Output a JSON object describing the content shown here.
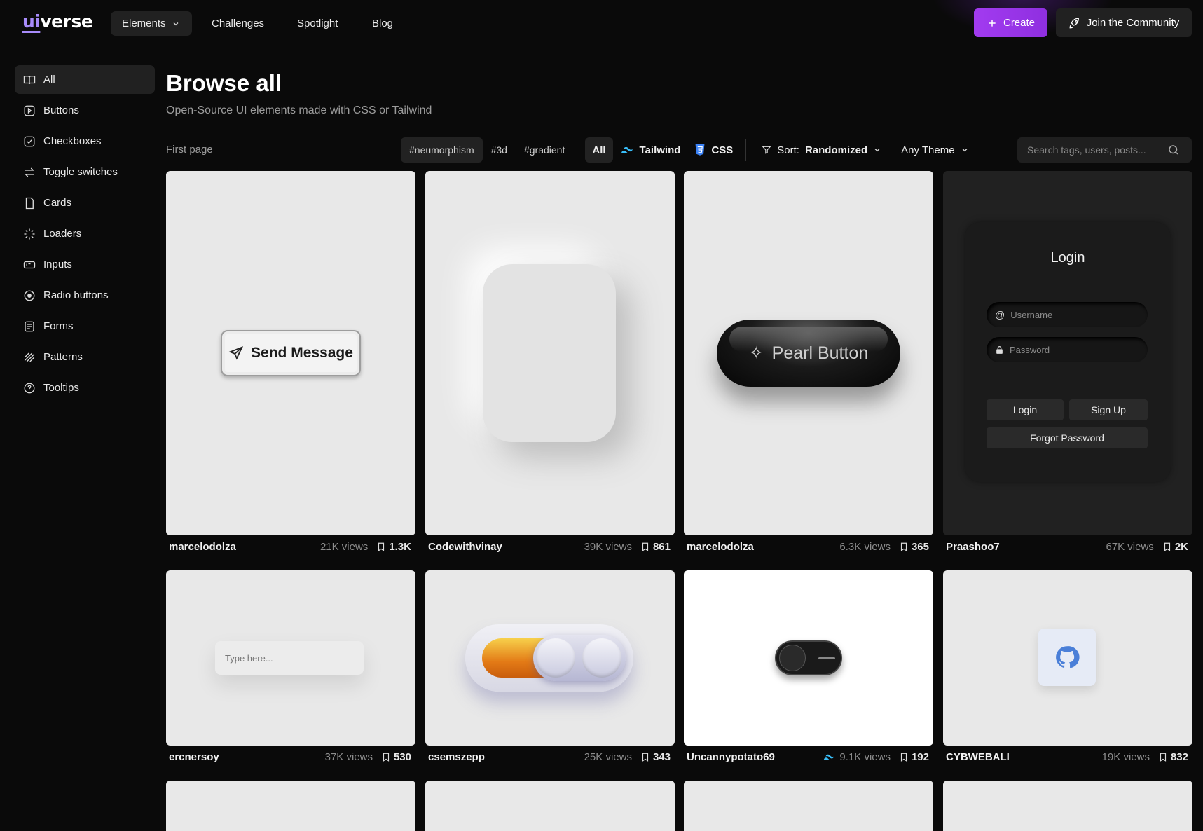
{
  "logo": {
    "ui": "ui",
    "rest": "verse"
  },
  "nav": {
    "elements": "Elements",
    "challenges": "Challenges",
    "spotlight": "Spotlight",
    "blog": "Blog"
  },
  "actions": {
    "create": "Create",
    "join": "Join the Community"
  },
  "sidebar": {
    "items": [
      {
        "label": "All",
        "icon": "book-open-icon"
      },
      {
        "label": "Buttons",
        "icon": "button-icon"
      },
      {
        "label": "Checkboxes",
        "icon": "checkbox-icon"
      },
      {
        "label": "Toggle switches",
        "icon": "arrows-swap-icon"
      },
      {
        "label": "Cards",
        "icon": "card-icon"
      },
      {
        "label": "Loaders",
        "icon": "loader-icon"
      },
      {
        "label": "Inputs",
        "icon": "input-icon"
      },
      {
        "label": "Radio buttons",
        "icon": "radio-icon"
      },
      {
        "label": "Forms",
        "icon": "form-icon"
      },
      {
        "label": "Patterns",
        "icon": "pattern-icon"
      },
      {
        "label": "Tooltips",
        "icon": "help-circle-icon"
      }
    ]
  },
  "header": {
    "title": "Browse all",
    "subtitle": "Open-Source UI elements made with CSS or Tailwind"
  },
  "filters": {
    "first_page": "First page",
    "tags": [
      "#neumorphism",
      "#3d",
      "#gradient"
    ],
    "frameworks": [
      "All",
      "Tailwind",
      "CSS"
    ],
    "sort_label": "Sort:",
    "sort_value": "Randomized",
    "theme": "Any Theme",
    "search_placeholder": "Search tags, users, posts..."
  },
  "cards": [
    {
      "author": "marcelodolza",
      "views": "21K views",
      "saves": "1.3K",
      "content": "Send Message"
    },
    {
      "author": "Codewithvinay",
      "views": "39K views",
      "saves": "861"
    },
    {
      "author": "marcelodolza",
      "views": "6.3K views",
      "saves": "365",
      "content": "Pearl Button"
    },
    {
      "author": "Praashoo7",
      "views": "67K views",
      "saves": "2K",
      "login": {
        "title": "Login",
        "username": "Username",
        "password": "Password",
        "login_btn": "Login",
        "signup_btn": "Sign Up",
        "forgot_btn": "Forgot Password"
      }
    },
    {
      "author": "ercnersoy",
      "views": "37K views",
      "saves": "530",
      "placeholder": "Type here..."
    },
    {
      "author": "csemszepp",
      "views": "25K views",
      "saves": "343"
    },
    {
      "author": "Uncannypotato69",
      "views": "9.1K views",
      "saves": "192"
    },
    {
      "author": "CYBWEBALI",
      "views": "19K views",
      "saves": "832"
    }
  ],
  "colors": {
    "accent": "#9f3cf0",
    "bg": "#0a0a0a",
    "card_bg": "#e8e8e8",
    "tailwind": "#38bdf8",
    "css": "#3b82f6"
  }
}
